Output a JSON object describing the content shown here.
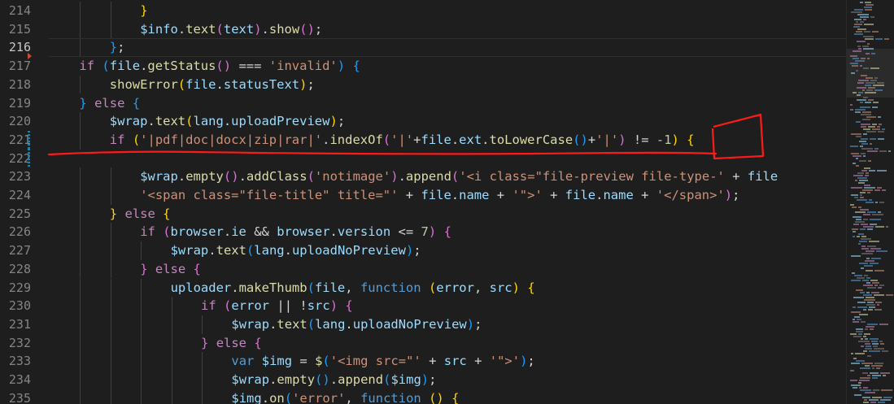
{
  "editor": {
    "colors": {
      "background": "#1e1e1e",
      "keyword": "#569cd6",
      "control": "#c586c0",
      "function": "#dcdcaa",
      "string": "#ce9178",
      "number": "#b5cea8",
      "variable": "#9cdcfe",
      "annotation": "#ff1a1a"
    },
    "active_line": "216",
    "lines": [
      {
        "num": "214",
        "indent": 3,
        "tokens": [
          [
            "}",
            "b1"
          ]
        ]
      },
      {
        "num": "215",
        "indent": 3,
        "tokens": [
          [
            "$info",
            "var"
          ],
          [
            ".",
            ""
          ],
          [
            "text",
            "fn"
          ],
          [
            "(",
            "b2"
          ],
          [
            "text",
            "var"
          ],
          [
            ")",
            "b2"
          ],
          [
            ".",
            ""
          ],
          [
            "show",
            "fn"
          ],
          [
            "(",
            "b2"
          ],
          [
            ")",
            "b2"
          ],
          [
            ";",
            ""
          ]
        ]
      },
      {
        "num": "216",
        "indent": 2,
        "tokens": [
          [
            "}",
            "b3"
          ],
          [
            ";",
            ""
          ]
        ]
      },
      {
        "num": "217",
        "indent": 1,
        "tokens": [
          [
            "if",
            "ctl"
          ],
          [
            " ",
            ""
          ],
          [
            "(",
            "b3"
          ],
          [
            "file",
            "var"
          ],
          [
            ".",
            ""
          ],
          [
            "getStatus",
            "fn"
          ],
          [
            "(",
            "b2"
          ],
          [
            ")",
            "b2"
          ],
          [
            " === ",
            ""
          ],
          [
            "'invalid'",
            "str"
          ],
          [
            ")",
            "b3"
          ],
          [
            " ",
            ""
          ],
          [
            "{",
            "b3"
          ]
        ]
      },
      {
        "num": "218",
        "indent": 2,
        "tokens": [
          [
            "showError",
            "fn"
          ],
          [
            "(",
            "b1"
          ],
          [
            "file",
            "var"
          ],
          [
            ".",
            ""
          ],
          [
            "statusText",
            "var"
          ],
          [
            ")",
            "b1"
          ],
          [
            ";",
            ""
          ]
        ]
      },
      {
        "num": "219",
        "indent": 1,
        "tokens": [
          [
            "}",
            "b3"
          ],
          [
            " ",
            ""
          ],
          [
            "else",
            "ctl"
          ],
          [
            " ",
            ""
          ],
          [
            "{",
            "b3"
          ]
        ]
      },
      {
        "num": "220",
        "indent": 2,
        "tokens": [
          [
            "$wrap",
            "var"
          ],
          [
            ".",
            ""
          ],
          [
            "text",
            "fn"
          ],
          [
            "(",
            "b1"
          ],
          [
            "lang",
            "var"
          ],
          [
            ".",
            ""
          ],
          [
            "uploadPreview",
            "var"
          ],
          [
            ")",
            "b1"
          ],
          [
            ";",
            ""
          ]
        ]
      },
      {
        "num": "221",
        "indent": 2,
        "tokens": [
          [
            "if",
            "ctl"
          ],
          [
            " ",
            ""
          ],
          [
            "(",
            "b1"
          ],
          [
            "'|pdf|doc|docx|zip|rar|'",
            "str"
          ],
          [
            ".",
            ""
          ],
          [
            "indexOf",
            "fn"
          ],
          [
            "(",
            "b2"
          ],
          [
            "'|'",
            "str"
          ],
          [
            "+",
            ""
          ],
          [
            "file",
            "var"
          ],
          [
            ".",
            ""
          ],
          [
            "ext",
            "var"
          ],
          [
            ".",
            ""
          ],
          [
            "toLowerCase",
            "fn"
          ],
          [
            "(",
            "b3"
          ],
          [
            ")",
            "b3"
          ],
          [
            "+",
            ""
          ],
          [
            "'|'",
            "str"
          ],
          [
            ")",
            "b2"
          ],
          [
            " != ",
            ""
          ],
          [
            "-1",
            "num"
          ],
          [
            ")",
            "b1"
          ],
          [
            " ",
            ""
          ],
          [
            "{",
            "b1"
          ]
        ]
      },
      {
        "num": "222",
        "indent": 0,
        "tokens": []
      },
      {
        "num": "223",
        "indent": 3,
        "tokens": [
          [
            "$wrap",
            "var"
          ],
          [
            ".",
            ""
          ],
          [
            "empty",
            "fn"
          ],
          [
            "(",
            "b2"
          ],
          [
            ")",
            "b2"
          ],
          [
            ".",
            ""
          ],
          [
            "addClass",
            "fn"
          ],
          [
            "(",
            "b2"
          ],
          [
            "'notimage'",
            "str"
          ],
          [
            ")",
            "b2"
          ],
          [
            ".",
            ""
          ],
          [
            "append",
            "fn"
          ],
          [
            "(",
            "b2"
          ],
          [
            "'<i class=\"file-preview file-type-'",
            "str"
          ],
          [
            " + ",
            ""
          ],
          [
            "file",
            "var"
          ]
        ]
      },
      {
        "num": "224",
        "indent": 3,
        "tokens": [
          [
            "'<span class=\"file-title\" title=\"'",
            "str"
          ],
          [
            " + ",
            ""
          ],
          [
            "file",
            "var"
          ],
          [
            ".",
            ""
          ],
          [
            "name",
            "var"
          ],
          [
            " + ",
            ""
          ],
          [
            "'\">'",
            "str"
          ],
          [
            " + ",
            ""
          ],
          [
            "file",
            "var"
          ],
          [
            ".",
            ""
          ],
          [
            "name",
            "var"
          ],
          [
            " + ",
            ""
          ],
          [
            "'</span>'",
            "str"
          ],
          [
            ")",
            "b2"
          ],
          [
            ";",
            ""
          ]
        ]
      },
      {
        "num": "225",
        "indent": 2,
        "tokens": [
          [
            "}",
            "b1"
          ],
          [
            " ",
            ""
          ],
          [
            "else",
            "ctl"
          ],
          [
            " ",
            ""
          ],
          [
            "{",
            "b1"
          ]
        ]
      },
      {
        "num": "226",
        "indent": 3,
        "tokens": [
          [
            "if",
            "ctl"
          ],
          [
            " ",
            ""
          ],
          [
            "(",
            "b2"
          ],
          [
            "browser",
            "var"
          ],
          [
            ".",
            ""
          ],
          [
            "ie",
            "var"
          ],
          [
            " && ",
            ""
          ],
          [
            "browser",
            "var"
          ],
          [
            ".",
            ""
          ],
          [
            "version",
            "var"
          ],
          [
            " <= ",
            ""
          ],
          [
            "7",
            "num"
          ],
          [
            ")",
            "b2"
          ],
          [
            " ",
            ""
          ],
          [
            "{",
            "b2"
          ]
        ]
      },
      {
        "num": "227",
        "indent": 4,
        "tokens": [
          [
            "$wrap",
            "var"
          ],
          [
            ".",
            ""
          ],
          [
            "text",
            "fn"
          ],
          [
            "(",
            "b3"
          ],
          [
            "lang",
            "var"
          ],
          [
            ".",
            ""
          ],
          [
            "uploadNoPreview",
            "var"
          ],
          [
            ")",
            "b3"
          ],
          [
            ";",
            ""
          ]
        ]
      },
      {
        "num": "228",
        "indent": 3,
        "tokens": [
          [
            "}",
            "b2"
          ],
          [
            " ",
            ""
          ],
          [
            "else",
            "ctl"
          ],
          [
            " ",
            ""
          ],
          [
            "{",
            "b2"
          ]
        ]
      },
      {
        "num": "229",
        "indent": 4,
        "tokens": [
          [
            "uploader",
            "var"
          ],
          [
            ".",
            ""
          ],
          [
            "makeThumb",
            "fn"
          ],
          [
            "(",
            "b3"
          ],
          [
            "file",
            "var"
          ],
          [
            ", ",
            ""
          ],
          [
            "function",
            "kw"
          ],
          [
            " ",
            ""
          ],
          [
            "(",
            "b1"
          ],
          [
            "error",
            "var"
          ],
          [
            ", ",
            ""
          ],
          [
            "src",
            "var"
          ],
          [
            ")",
            "b1"
          ],
          [
            " ",
            ""
          ],
          [
            "{",
            "b1"
          ]
        ]
      },
      {
        "num": "230",
        "indent": 5,
        "tokens": [
          [
            "if",
            "ctl"
          ],
          [
            " ",
            ""
          ],
          [
            "(",
            "b2"
          ],
          [
            "error",
            "var"
          ],
          [
            " || !",
            ""
          ],
          [
            "src",
            "var"
          ],
          [
            ")",
            "b2"
          ],
          [
            " ",
            ""
          ],
          [
            "{",
            "b2"
          ]
        ]
      },
      {
        "num": "231",
        "indent": 6,
        "tokens": [
          [
            "$wrap",
            "var"
          ],
          [
            ".",
            ""
          ],
          [
            "text",
            "fn"
          ],
          [
            "(",
            "b3"
          ],
          [
            "lang",
            "var"
          ],
          [
            ".",
            ""
          ],
          [
            "uploadNoPreview",
            "var"
          ],
          [
            ")",
            "b3"
          ],
          [
            ";",
            ""
          ]
        ]
      },
      {
        "num": "232",
        "indent": 5,
        "tokens": [
          [
            "}",
            "b2"
          ],
          [
            " ",
            ""
          ],
          [
            "else",
            "ctl"
          ],
          [
            " ",
            ""
          ],
          [
            "{",
            "b2"
          ]
        ]
      },
      {
        "num": "233",
        "indent": 6,
        "tokens": [
          [
            "var",
            "kw"
          ],
          [
            " ",
            ""
          ],
          [
            "$img",
            "var"
          ],
          [
            " = ",
            ""
          ],
          [
            "$",
            "fn"
          ],
          [
            "(",
            "b3"
          ],
          [
            "'<img src=\"'",
            "str"
          ],
          [
            " + ",
            ""
          ],
          [
            "src",
            "var"
          ],
          [
            " + ",
            ""
          ],
          [
            "'\">'",
            "str"
          ],
          [
            ")",
            "b3"
          ],
          [
            ";",
            ""
          ]
        ]
      },
      {
        "num": "234",
        "indent": 6,
        "tokens": [
          [
            "$wrap",
            "var"
          ],
          [
            ".",
            ""
          ],
          [
            "empty",
            "fn"
          ],
          [
            "(",
            "b3"
          ],
          [
            ")",
            "b3"
          ],
          [
            ".",
            ""
          ],
          [
            "append",
            "fn"
          ],
          [
            "(",
            "b3"
          ],
          [
            "$img",
            "var"
          ],
          [
            ")",
            "b3"
          ],
          [
            ";",
            ""
          ]
        ]
      },
      {
        "num": "235",
        "indent": 6,
        "tokens": [
          [
            "$img",
            "var"
          ],
          [
            ".",
            ""
          ],
          [
            "on",
            "fn"
          ],
          [
            "(",
            "b3"
          ],
          [
            "'error'",
            "str"
          ],
          [
            ", ",
            ""
          ],
          [
            "function",
            "kw"
          ],
          [
            " ",
            ""
          ],
          [
            "(",
            "b1"
          ],
          [
            ")",
            "b1"
          ],
          [
            " ",
            ""
          ],
          [
            "{",
            "b1"
          ]
        ]
      }
    ]
  }
}
